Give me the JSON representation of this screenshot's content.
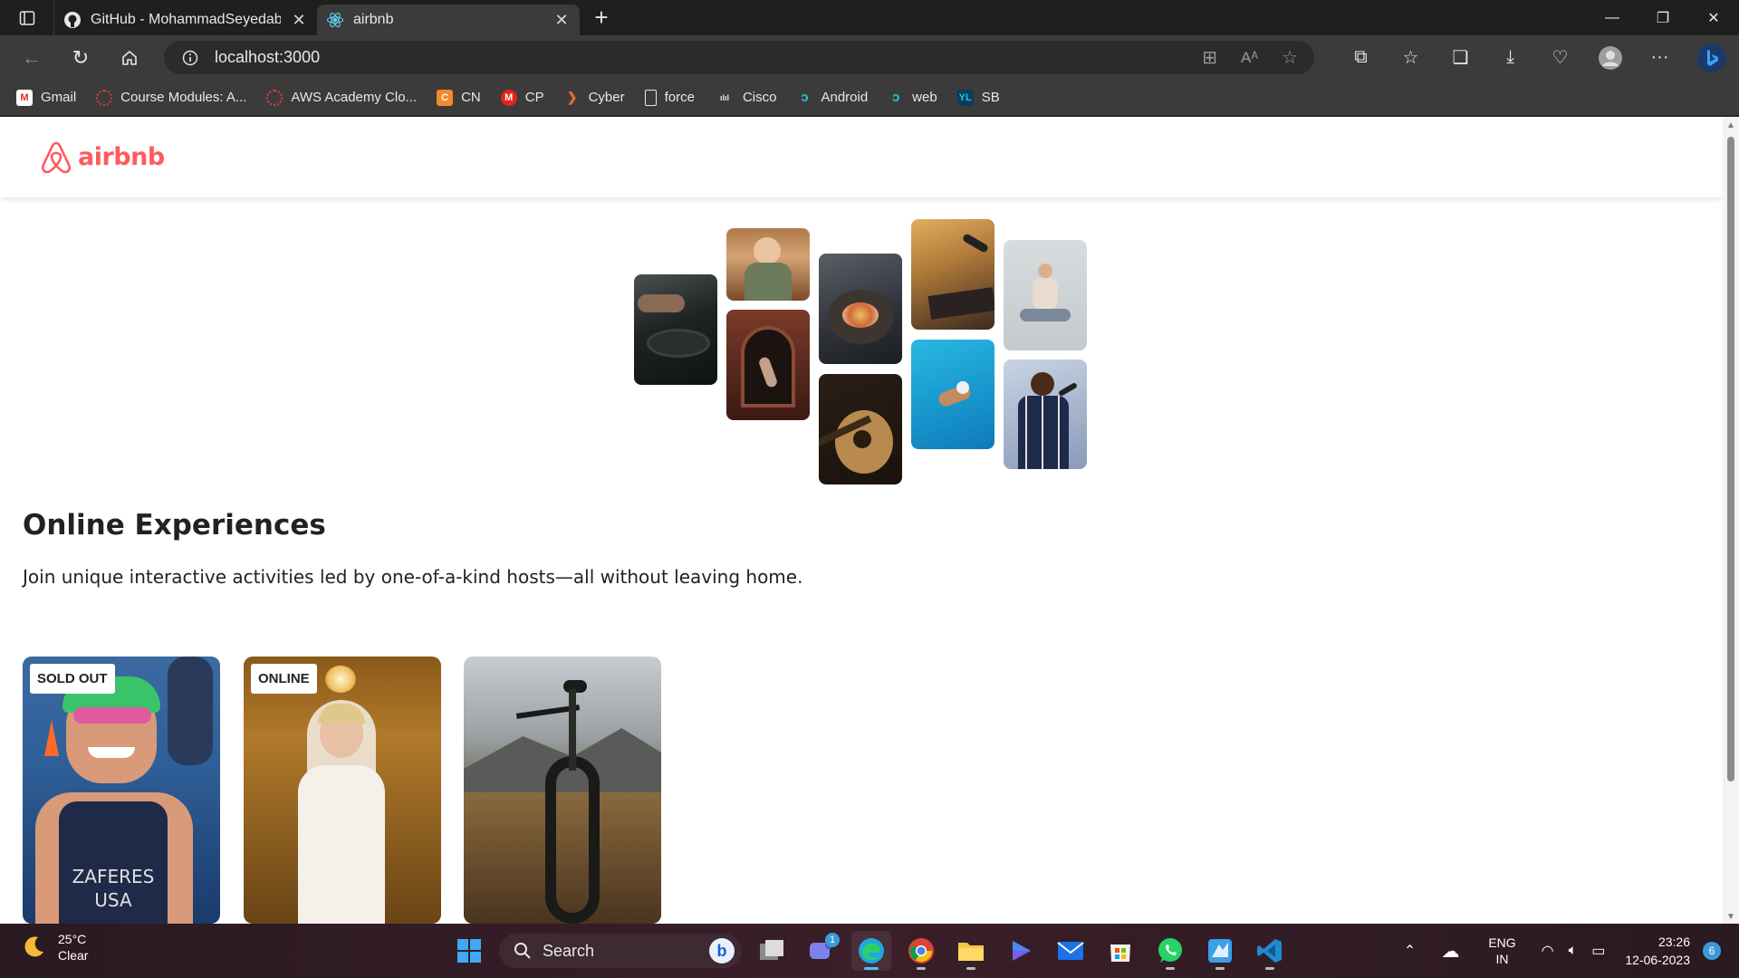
{
  "browser": {
    "tabs": [
      {
        "title": "GitHub - MohammadSeyedabadi",
        "active": false
      },
      {
        "title": "airbnb",
        "active": true
      }
    ],
    "url": "localhost:3000",
    "favorites": [
      {
        "label": "Gmail",
        "icon": "gmail-icon",
        "color": "#d93025"
      },
      {
        "label": "Course Modules: A...",
        "icon": "canvas-icon",
        "color": "#e23e3e"
      },
      {
        "label": "AWS Academy Clo...",
        "icon": "canvas-icon",
        "color": "#e23e3e"
      },
      {
        "label": "CN",
        "icon": "cn-icon",
        "color": "#f28b2c"
      },
      {
        "label": "CP",
        "icon": "cp-icon",
        "color": "#e1251b"
      },
      {
        "label": "Cyber",
        "icon": "cyber-icon",
        "color": "#e86a2c"
      },
      {
        "label": "force",
        "icon": "page-icon",
        "color": "#e8e8e8"
      },
      {
        "label": "Cisco",
        "icon": "cisco-icon",
        "color": "#e8e8e8"
      },
      {
        "label": "Android",
        "icon": "swirl-icon",
        "color": "#27c7d4"
      },
      {
        "label": "web",
        "icon": "swirl-icon",
        "color": "#27c7d4"
      },
      {
        "label": "SB",
        "icon": "sb-icon",
        "color": "#1fa4c7"
      }
    ]
  },
  "site": {
    "logo_text": "airbnb",
    "brand_color": "#ff5a5f",
    "hero_title": "Online Experiences",
    "hero_subtitle": "Join unique interactive activities led by one-of-a-kind hosts—all without leaving home.",
    "cards": [
      {
        "badge": "SOLD OUT",
        "image": "swimmer-photo"
      },
      {
        "badge": "ONLINE",
        "image": "bride-photo"
      },
      {
        "badge": "",
        "image": "mountain-bike-photo"
      }
    ]
  },
  "taskbar": {
    "weather_temp": "25°C",
    "weather_desc": "Clear",
    "search_label": "Search",
    "teams_badge": "1",
    "lang_top": "ENG",
    "lang_bottom": "IN",
    "time": "23:26",
    "date": "12-06-2023",
    "notifications": "6"
  }
}
